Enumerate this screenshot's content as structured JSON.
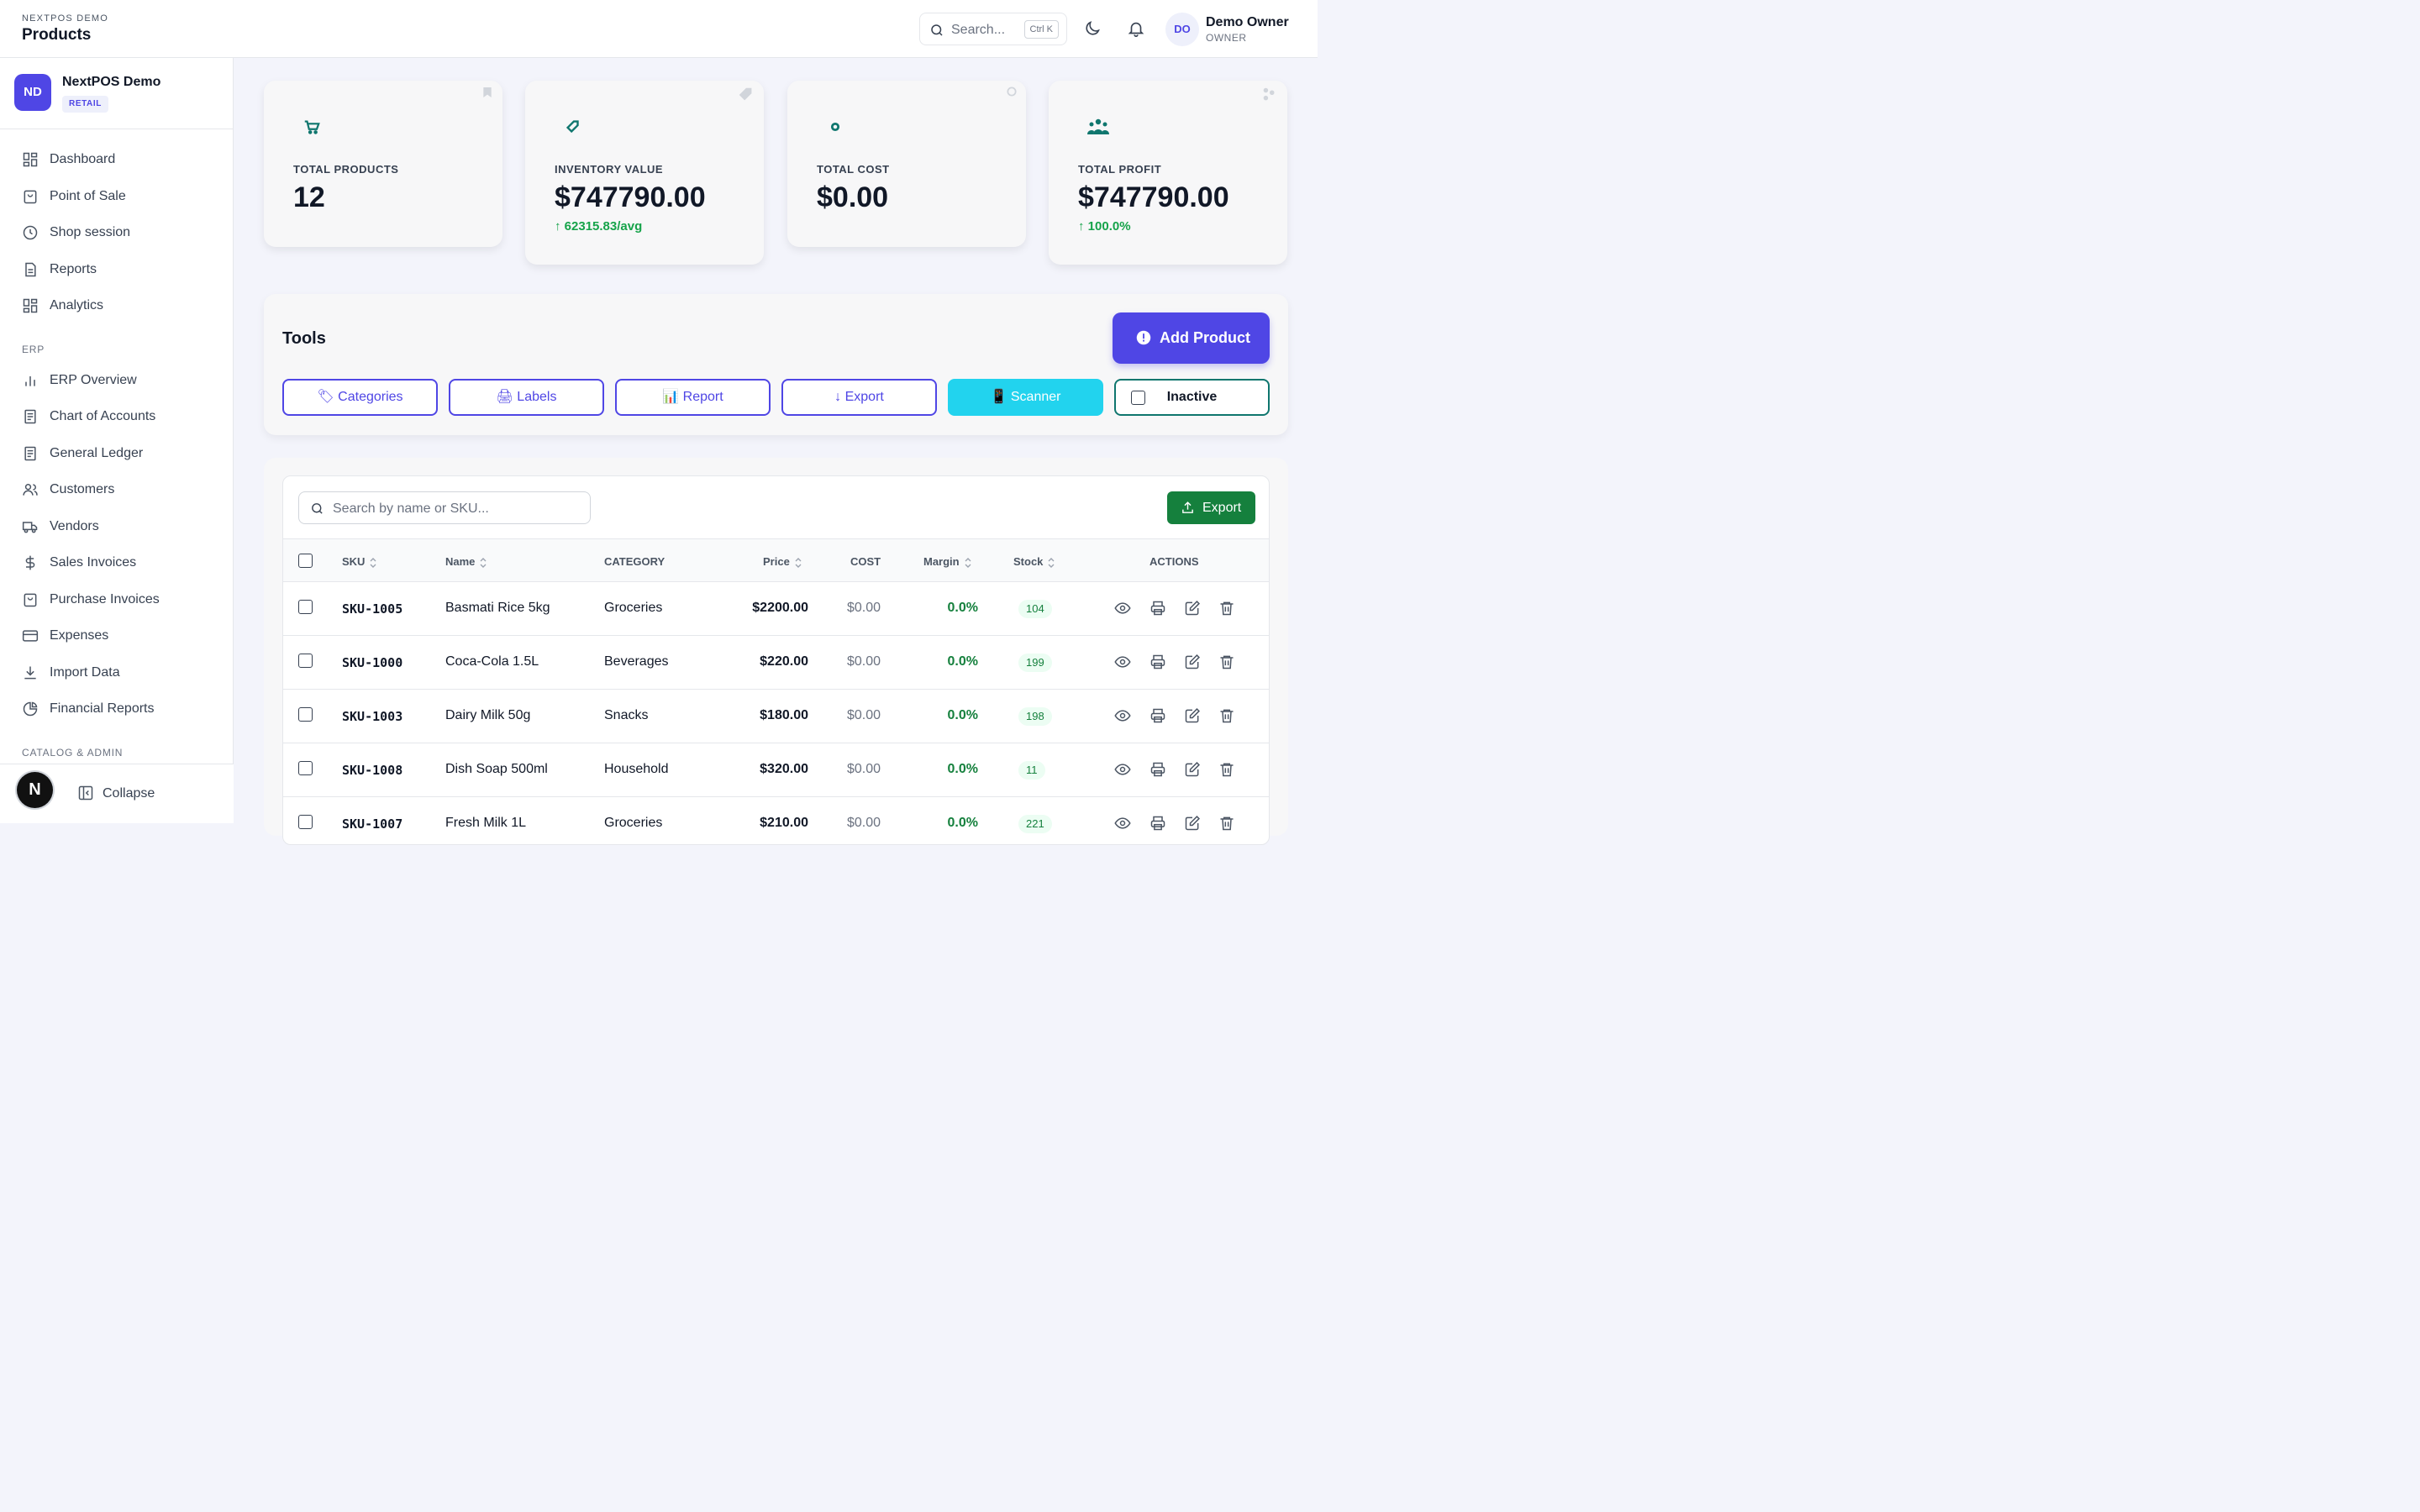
{
  "header": {
    "org_caption": "NEXTPOS DEMO",
    "title": "Products",
    "search_placeholder": "Search...",
    "search_shortcut": "Ctrl K",
    "user_initials": "DO",
    "user_name": "Demo Owner",
    "user_role": "OWNER"
  },
  "sidebar": {
    "org_initials": "ND",
    "org_name": "NextPOS Demo",
    "org_type": "RETAIL",
    "items": [
      {
        "label": "Dashboard",
        "icon": "grid-icon"
      },
      {
        "label": "Point of Sale",
        "icon": "shopping-bag-icon"
      },
      {
        "label": "Shop session",
        "icon": "clock-icon"
      },
      {
        "label": "Reports",
        "icon": "document-icon"
      },
      {
        "label": "Analytics",
        "icon": "grid-icon"
      }
    ],
    "section_erp": "ERP",
    "erp_items": [
      {
        "label": "ERP Overview",
        "icon": "bar-chart-icon"
      },
      {
        "label": "Chart of Accounts",
        "icon": "ledger-icon"
      },
      {
        "label": "General Ledger",
        "icon": "ledger-icon"
      },
      {
        "label": "Customers",
        "icon": "users-icon"
      },
      {
        "label": "Vendors",
        "icon": "truck-icon"
      },
      {
        "label": "Sales Invoices",
        "icon": "dollar-icon"
      },
      {
        "label": "Purchase Invoices",
        "icon": "shopping-bag-icon"
      },
      {
        "label": "Expenses",
        "icon": "credit-card-icon"
      },
      {
        "label": "Import Data",
        "icon": "download-icon"
      },
      {
        "label": "Financial Reports",
        "icon": "pie-chart-icon"
      }
    ],
    "section_catalog": "CATALOG & ADMIN",
    "collapse_label": "Collapse",
    "logo_letter": "N"
  },
  "stats": [
    {
      "label": "TOTAL PRODUCTS",
      "value": "12",
      "trend": "",
      "icon": "cart-icon"
    },
    {
      "label": "INVENTORY VALUE",
      "value": "$747790.00",
      "trend": "62315.83/avg",
      "icon": "tag-icon"
    },
    {
      "label": "TOTAL COST",
      "value": "$0.00",
      "trend": "",
      "icon": "coin-icon"
    },
    {
      "label": "TOTAL PROFIT",
      "value": "$747790.00",
      "trend": "100.0%",
      "icon": "team-icon"
    }
  ],
  "tools": {
    "title": "Tools",
    "add_product": "Add Product",
    "buttons": [
      "🏷 Categories",
      "🖨 Labels",
      "📊 Report",
      "↓ Export",
      "📱 Scanner",
      "Inactive"
    ]
  },
  "table": {
    "search_placeholder": "Search by name or SKU...",
    "export_label": "Export",
    "columns": [
      "SKU",
      "Name",
      "CATEGORY",
      "Price",
      "COST",
      "Margin",
      "Stock",
      "ACTIONS"
    ],
    "rows": [
      {
        "sku": "SKU-1005",
        "name": "Basmati Rice 5kg",
        "category": "Groceries",
        "price": "$2200.00",
        "cost": "$0.00",
        "margin": "0.0%",
        "stock": "104"
      },
      {
        "sku": "SKU-1000",
        "name": "Coca-Cola 1.5L",
        "category": "Beverages",
        "price": "$220.00",
        "cost": "$0.00",
        "margin": "0.0%",
        "stock": "199"
      },
      {
        "sku": "SKU-1003",
        "name": "Dairy Milk 50g",
        "category": "Snacks",
        "price": "$180.00",
        "cost": "$0.00",
        "margin": "0.0%",
        "stock": "198"
      },
      {
        "sku": "SKU-1008",
        "name": "Dish Soap 500ml",
        "category": "Household",
        "price": "$320.00",
        "cost": "$0.00",
        "margin": "0.0%",
        "stock": "11"
      },
      {
        "sku": "SKU-1007",
        "name": "Fresh Milk 1L",
        "category": "Groceries",
        "price": "$210.00",
        "cost": "$0.00",
        "margin": "0.0%",
        "stock": "221"
      }
    ]
  },
  "colors": {
    "primary": "#4f46e5",
    "success": "#15803d",
    "accent_cyan": "#22d3ee",
    "teal": "#0f766e"
  }
}
